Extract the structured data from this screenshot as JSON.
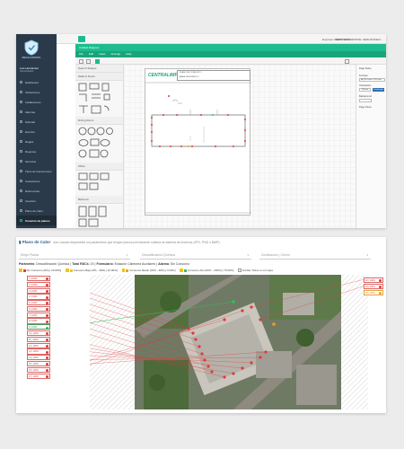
{
  "sidebar": {
    "brand": "SMIGN CONTROL",
    "user": "Luis Hernández",
    "role": "Administrador",
    "items": [
      {
        "label": "Dashboard"
      },
      {
        "label": "Ubicaciones"
      },
      {
        "label": "Instalaciones"
      },
      {
        "label": "Alarmas"
      },
      {
        "label": "Historial"
      },
      {
        "label": "Eventos"
      },
      {
        "label": "Reglas"
      },
      {
        "label": "Reportes"
      },
      {
        "label": "Servicios"
      },
      {
        "label": "Tipos de instrumentos"
      },
      {
        "label": "Anotaciones"
      },
      {
        "label": "Referencias"
      },
      {
        "label": "Usuarios"
      },
      {
        "label": "Plano de Calor"
      },
      {
        "label": "Creación de planos",
        "active": true
      }
    ]
  },
  "topbar": {
    "tenant": "Empresa: DEMO/SMIG",
    "user": "DEMO ENTERPRISE: HERNANDEZ L."
  },
  "drawio": {
    "title": "Untitled Diagram",
    "menu": [
      "File",
      "Edit",
      "Insert",
      "Arrange",
      "Help"
    ],
    "sections": [
      "Search Shapes",
      "Walls & Doors",
      "Dining Room",
      "Office",
      "Bedroom"
    ],
    "page_header": {
      "cell1": "PLANO DE CONDUCTO",
      "cell2": "AREA: FRIGORIFICO"
    },
    "logo": "CENTRALIMP",
    "props": {
      "panel_title": "Page Setup",
      "format_label": "Formato",
      "format_value": "A4 (210 mm x 297 mm)",
      "orientation_label": "Orientación",
      "portrait": "Portrait",
      "landscape": "Landscape",
      "background_label": "Background",
      "background_value": "",
      "pages_label": "Page Views"
    }
  },
  "heatmap": {
    "title": "Plano de Calor",
    "subtitle": "Aún cuando disponibles los parámetros que tengan planos previamente subidos al sistema de Archivos (JPG, PNG o BMP).",
    "filters": [
      {
        "placeholder": "Elegir Planta"
      },
      {
        "placeholder": "Descalibración Química"
      },
      {
        "placeholder": "Zonificación | Clerón"
      }
    ],
    "info": {
      "parameter_label": "Parámetro",
      "parameter_value": "Descalibración Química",
      "total_label": "Total RDCs",
      "total_value": "20",
      "formula_label": "Formulario",
      "formula_value": "Estación Cabecera Auxiliares",
      "status_label": "Alarma",
      "status_value": "Sin Consumo"
    },
    "legend": [
      {
        "label": "Sin Consumo (0%) [ 20.00%]",
        "color": "#e03a3a"
      },
      {
        "label": "Consumo Bajo (0% - 30%) [ 10.00%]",
        "color": "#f0c419"
      },
      {
        "label": "Consumo Medio (30% - 60%) [ 0.00%]",
        "color": "#f0a020"
      },
      {
        "label": "Consumo Alto (60% - 100%) [ 70.00%]",
        "color": "#2fbf5b"
      }
    ],
    "hide_labels": "Ocultar Todos en el mapa",
    "left_labels": [
      {
        "text": "1 | 100%",
        "status": "alarm"
      },
      {
        "text": "2 | 100%",
        "status": "alarm"
      },
      {
        "text": "3 | 100%",
        "status": "alarm"
      },
      {
        "text": "4 | 100%",
        "status": "alarm"
      },
      {
        "text": "5 | 100%",
        "status": "alarm"
      },
      {
        "text": "6 | 100%",
        "status": "alarm"
      },
      {
        "text": "7 | 100%",
        "status": "alarm"
      },
      {
        "text": "8 | 100%",
        "status": "alarm"
      },
      {
        "text": "9 | 100%",
        "status": "ok"
      },
      {
        "text": "10 | 100%",
        "status": "alarm"
      },
      {
        "text": "11 | 100%",
        "status": "alarm"
      },
      {
        "text": "12 | 100%",
        "status": "alarm"
      },
      {
        "text": "13 | 100%",
        "status": "alarm"
      },
      {
        "text": "14 | 100%",
        "status": "alarm"
      },
      {
        "text": "15 | 100%",
        "status": "alarm"
      },
      {
        "text": "16 | 100%",
        "status": "alarm"
      },
      {
        "text": "17 | 100%",
        "status": "alarm"
      }
    ],
    "right_labels": [
      {
        "text": "18 | 100%",
        "status": "alarm"
      },
      {
        "text": "19 | 100%",
        "status": "alarm"
      },
      {
        "text": "20 | 100%",
        "status": "warn"
      }
    ]
  },
  "colors": {
    "accent": "#1dbc8e",
    "sidebar": "#2a3a4a",
    "alarm": "#e03a3a",
    "ok": "#2fbf5b",
    "title_blue": "#2c5d8a"
  }
}
